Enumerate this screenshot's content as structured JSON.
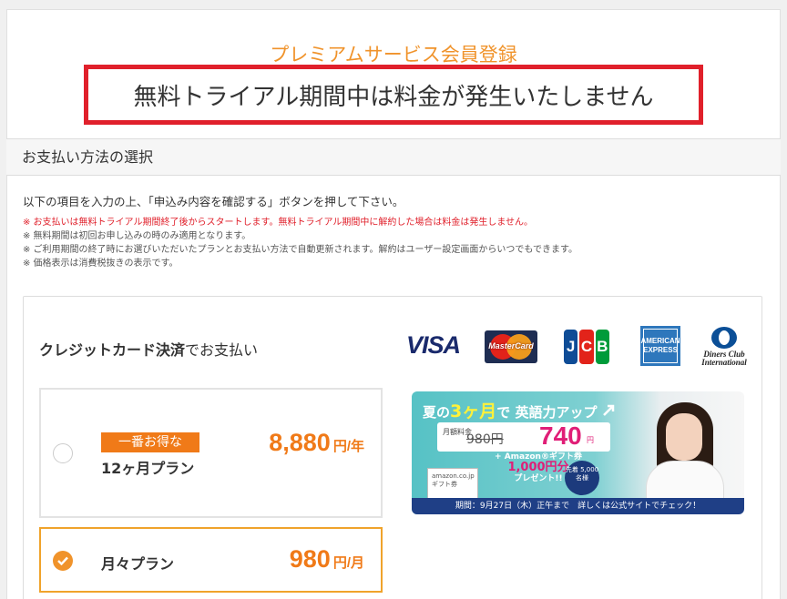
{
  "header": {
    "subtitle": "プレミアムサービス会員登録",
    "notice": "無料トライアル期間中は料金が発生いたしません"
  },
  "section": {
    "title": "お支払い方法の選択"
  },
  "intro": "以下の項目を入力の上、「申込み内容を確認する」ボタンを押して下さい。",
  "notes": [
    "※ お支払いは無料トライアル期間終了後からスタートします。無料トライアル期間中に解約した場合は料金は発生しません。",
    "※ 無料期間は初回お申し込みの時のみ適用となります。",
    "※ ご利用期間の終了時にお選びいただいたプランとお支払い方法で自動更新されます。解約はユーザー設定画面からいつでもできます。",
    "※ 価格表示は消費税抜きの表示です。"
  ],
  "payment": {
    "title_bold": "クレジットカード決済",
    "title_rest": "でお支払い",
    "brands": {
      "visa": "VISA",
      "mastercard": "MasterCard",
      "jcb": [
        "J",
        "C",
        "B"
      ],
      "amex": "AMERICAN EXPRESS",
      "diners": "Diners Club International"
    }
  },
  "plans": [
    {
      "badge": "一番お得な",
      "name": "12ヶ月プラン",
      "price": "8,880",
      "unit": "円/年",
      "selected": false
    },
    {
      "name": "月々プラン",
      "price": "980",
      "unit": "円/月",
      "selected": true
    }
  ],
  "ad": {
    "headline_a": "夏の",
    "headline_b": "3ヶ月",
    "headline_c": "で 英語力アップ",
    "label": "月額料金",
    "old_price": "980円",
    "new_price": "740",
    "yen": "円",
    "gift_line1": "+ Amazon®ギフト券",
    "gift_amount": "1,000円分",
    "gift_line3": "プレゼント!!",
    "card_text": "amazon.co.jp ギフト券",
    "seal": "先着 5,000 名様",
    "footer": "期間：9月27日（木）正午まで　詳しくは公式サイトでチェック！"
  },
  "colors": {
    "accent": "#f07a18",
    "notice_border": "#e0202b",
    "subtitle": "#f0932b"
  }
}
